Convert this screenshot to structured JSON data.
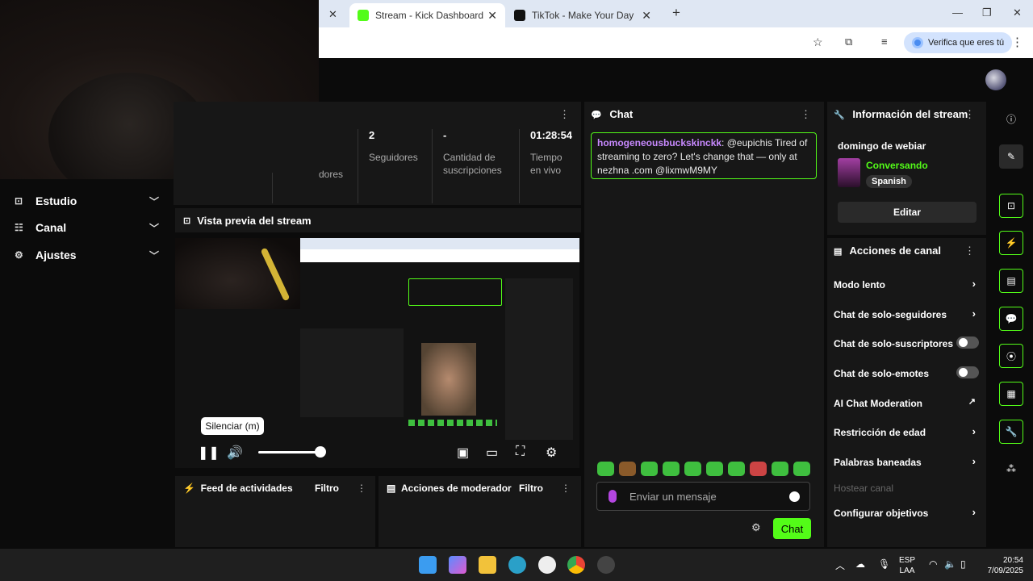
{
  "browser": {
    "tabs": [
      {
        "title": "Stream - Kick Dashboard",
        "active": true
      },
      {
        "title": "TikTok - Make Your Day",
        "active": false
      }
    ],
    "verify_label": "Verifica que eres tú"
  },
  "sidebar": {
    "items": [
      {
        "label": "Estudio",
        "icon": "studio-icon"
      },
      {
        "label": "Canal",
        "icon": "channel-icon"
      },
      {
        "label": "Ajustes",
        "icon": "gear-icon"
      }
    ]
  },
  "stats": {
    "partial_label": "dores",
    "followers_value": "2",
    "followers_label": "Seguidores",
    "subs_value": "-",
    "subs_label_1": "Cantidad de",
    "subs_label_2": "suscripciones",
    "time_value": "01:28:54",
    "time_label_1": "Tiempo",
    "time_label_2": "en vivo"
  },
  "preview": {
    "title": "Vista previa del stream",
    "tooltip": "Silenciar (m)",
    "volume_level": 1.0
  },
  "activity_feed": {
    "title": "Feed de actividades",
    "filter": "Filtro"
  },
  "mod_actions": {
    "title": "Acciones de moderador",
    "filter": "Filtro"
  },
  "chat": {
    "title": "Chat",
    "message": {
      "user": "homogeneousbuckskinckk",
      "text": ": @eupichis Tired of streaming to zero? Let's change that — only at nezhna .com @lixmwM9MY"
    },
    "input_placeholder": "Enviar un mensaje",
    "send_label": "Chat"
  },
  "stream_info": {
    "title": "Información del stream",
    "stream_title": "domingo de webiar",
    "category": "Conversando",
    "language": "Spanish",
    "edit_label": "Editar"
  },
  "channel_actions": {
    "title": "Acciones de canal",
    "items": [
      {
        "label": "Modo lento",
        "control": "arrow"
      },
      {
        "label": "Chat de solo-seguidores",
        "control": "arrow"
      },
      {
        "label": "Chat de solo-suscriptores",
        "control": "toggle"
      },
      {
        "label": "Chat de solo-emotes",
        "control": "toggle"
      },
      {
        "label": "AI Chat Moderation",
        "control": "external"
      },
      {
        "label": "Restricción de edad",
        "control": "arrow"
      },
      {
        "label": "Palabras baneadas",
        "control": "arrow"
      },
      {
        "label": "Hostear canal",
        "control": "none"
      },
      {
        "label": "Configurar objetivos",
        "control": "arrow"
      }
    ]
  },
  "taskbar": {
    "language_1": "ESP",
    "language_2": "LAA",
    "time": "20:54",
    "date": "7/09/2025"
  },
  "colors": {
    "accent": "#53fc18",
    "username": "#c889ff"
  }
}
